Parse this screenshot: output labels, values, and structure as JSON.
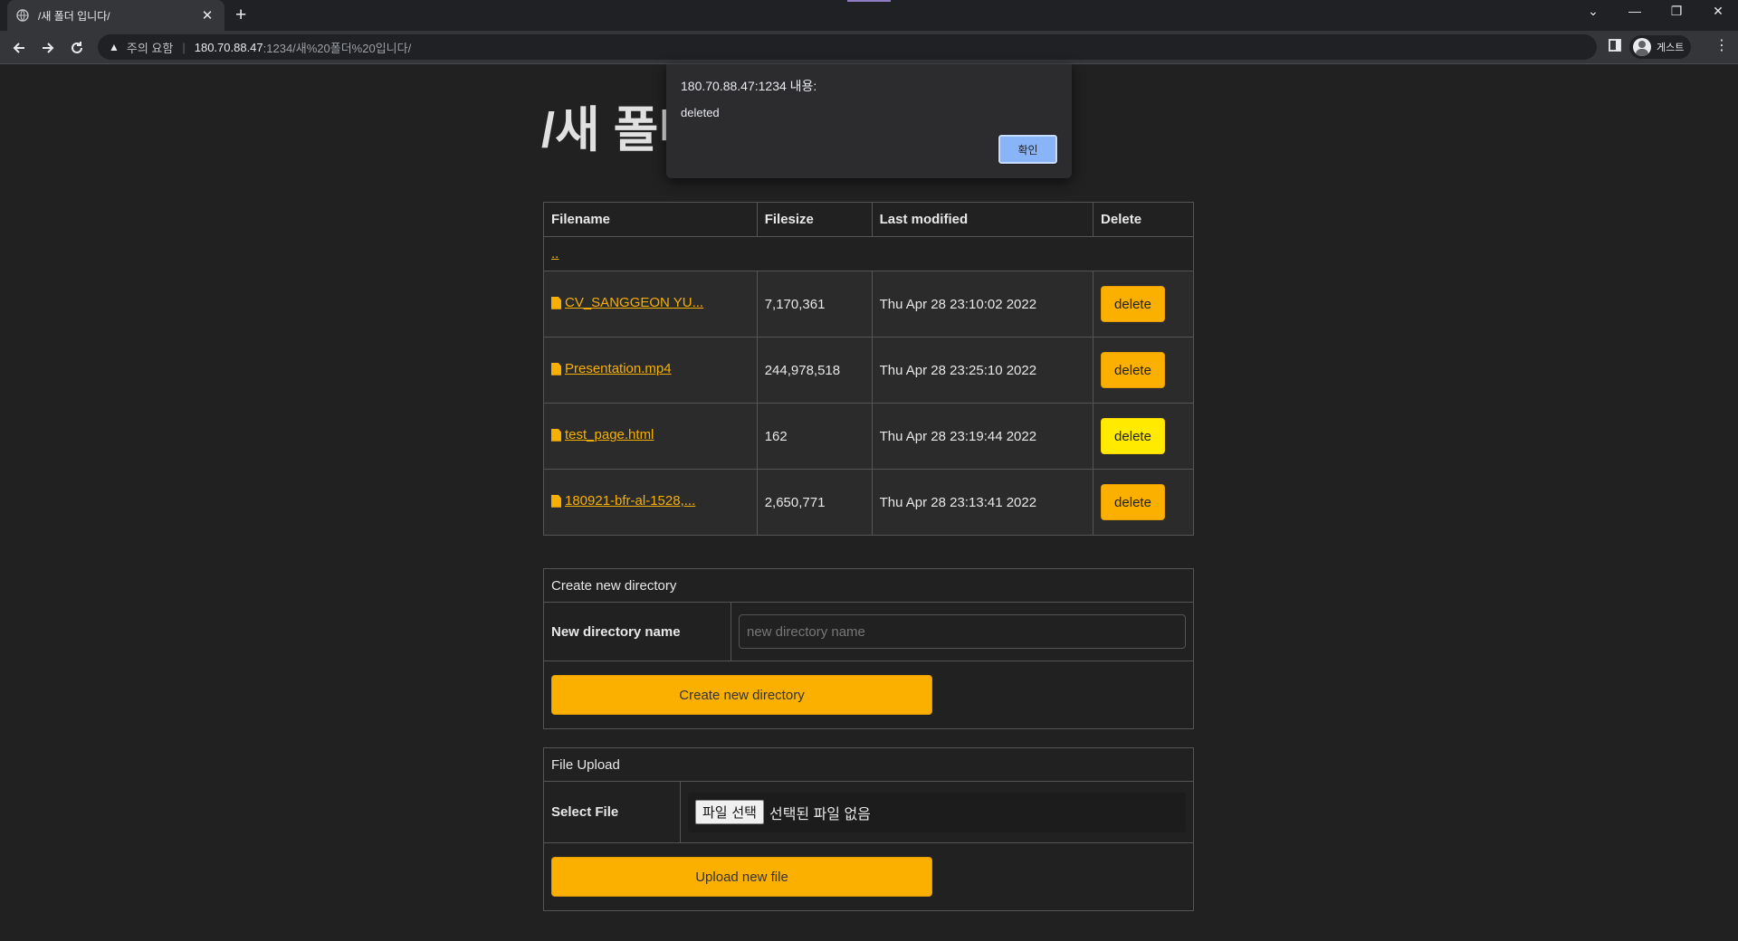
{
  "browser": {
    "tab_title": "/새 폴더 입니다/",
    "tab_close": "✕",
    "new_tab": "+",
    "window_controls": {
      "dropdown": "⌄",
      "minimize": "—",
      "restore": "❐",
      "close": "✕"
    },
    "security_warning": "주의 요함",
    "url_host": "180.70.88.47",
    "url_rest": ":1234/새%20폴더%20입니다/",
    "profile_name": "게스트"
  },
  "page": {
    "title": "/새 폴더 입니다/",
    "table": {
      "headers": [
        "Filename",
        "Filesize",
        "Last modified",
        "Delete"
      ],
      "parent_link": "..",
      "rows": [
        {
          "name": "CV_SANGGEON YU...",
          "size": "7,170,361",
          "modified": "Thu Apr 28 23:10:02 2022",
          "delete": "delete"
        },
        {
          "name": "Presentation.mp4",
          "size": "244,978,518",
          "modified": "Thu Apr 28 23:25:10 2022",
          "delete": "delete"
        },
        {
          "name": "test_page.html",
          "size": "162",
          "modified": "Thu Apr 28 23:19:44 2022",
          "delete": "delete"
        },
        {
          "name": "180921-bfr-al-1528,...",
          "size": "2,650,771",
          "modified": "Thu Apr 28 23:13:41 2022",
          "delete": "delete"
        }
      ]
    },
    "create_dir": {
      "heading": "Create new directory",
      "label": "New directory name",
      "placeholder": "new directory name",
      "button": "Create new directory"
    },
    "upload": {
      "heading": "File Upload",
      "label": "Select File",
      "choose_button": "파일 선택",
      "no_file": "선택된 파일 없음",
      "button": "Upload new file"
    }
  },
  "dialog": {
    "title": "180.70.88.47:1234 내용:",
    "message": "deleted",
    "ok": "확인"
  },
  "colors": {
    "accent": "#fbb000",
    "hover_button": "#ffea00",
    "background": "#212121"
  }
}
